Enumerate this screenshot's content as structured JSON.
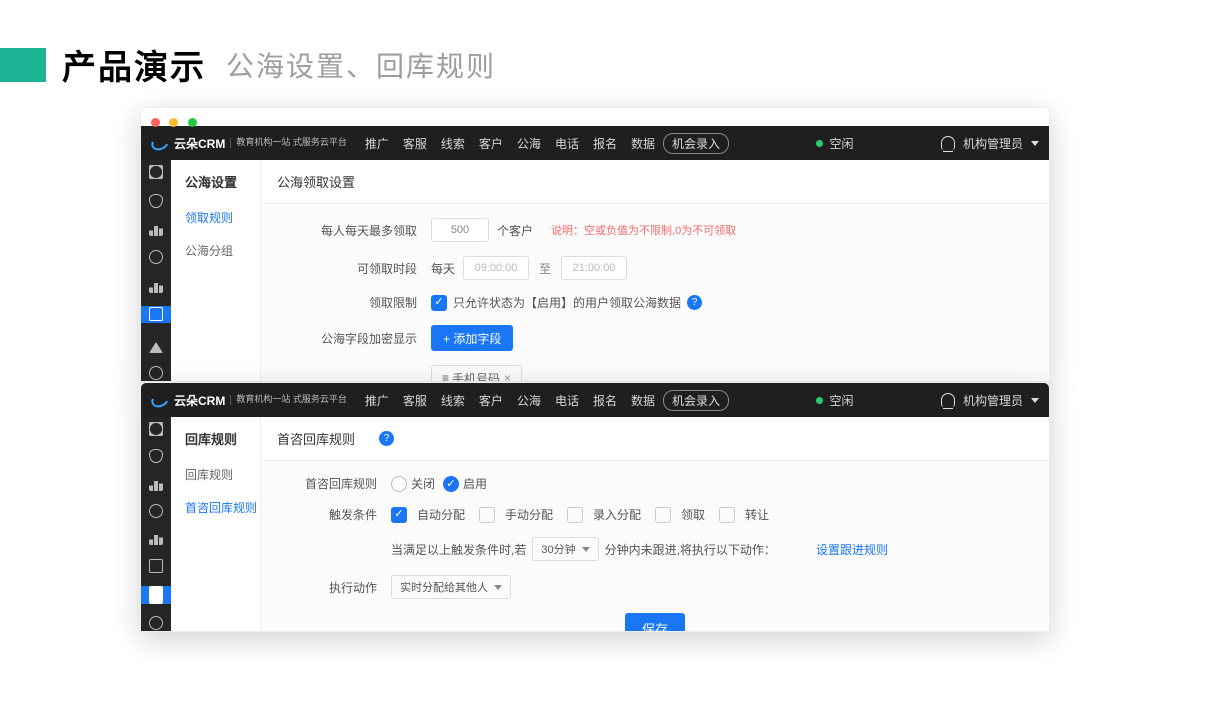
{
  "slide": {
    "title": "产品演示",
    "subtitle": "公海设置、回库规则"
  },
  "topbar": {
    "logo_text": "云朵CRM",
    "logo_sub": "教育机构一站\n式服务云平台",
    "nav": [
      "推广",
      "客服",
      "线索",
      "客户",
      "公海",
      "电话",
      "报名",
      "数据"
    ],
    "opp_button": "机会录入",
    "status": "空闲",
    "user": "机构管理员"
  },
  "win1": {
    "subnav_title": "公海设置",
    "subnav_items": [
      "领取规则",
      "公海分组"
    ],
    "content_title": "公海领取设置",
    "form": {
      "max_label": "每人每天最多领取",
      "max_value": "500",
      "max_unit": "个客户",
      "max_note_prefix": "说明：",
      "max_note": "空或负值为不限制,0为不可领取",
      "time_label": "可领取时段",
      "time_everyday": "每天",
      "time_from": "09:00:00",
      "time_sep": "至",
      "time_to": "21:00:00",
      "limit_label": "领取限制",
      "limit_text": "只允许状态为【启用】的用户领取公海数据",
      "encrypt_label": "公海字段加密显示",
      "add_field_btn": "+ 添加字段",
      "chip_text": "手机号码"
    }
  },
  "win2": {
    "subnav_title": "回库规则",
    "subnav_items": [
      "回库规则",
      "首咨回库规则"
    ],
    "content_title": "首咨回库规则",
    "form": {
      "rule_label": "首咨回库规则",
      "radio_off": "关闭",
      "radio_on": "启用",
      "trigger_label": "触发条件",
      "cb": [
        "自动分配",
        "手动分配",
        "录入分配",
        "领取",
        "转让"
      ],
      "sentence_a": "当满足以上触发条件时,若",
      "sentence_dur": "30分钟",
      "sentence_b": "分钟内未跟进,将执行以下动作：",
      "set_rule": "设置跟进规则",
      "action_label": "执行动作",
      "action_sel": "实时分配给其他人",
      "save": "保存"
    }
  },
  "sidebar_icons": [
    "grid",
    "shield",
    "chart",
    "person",
    "chart",
    "house",
    "tri",
    "person"
  ]
}
